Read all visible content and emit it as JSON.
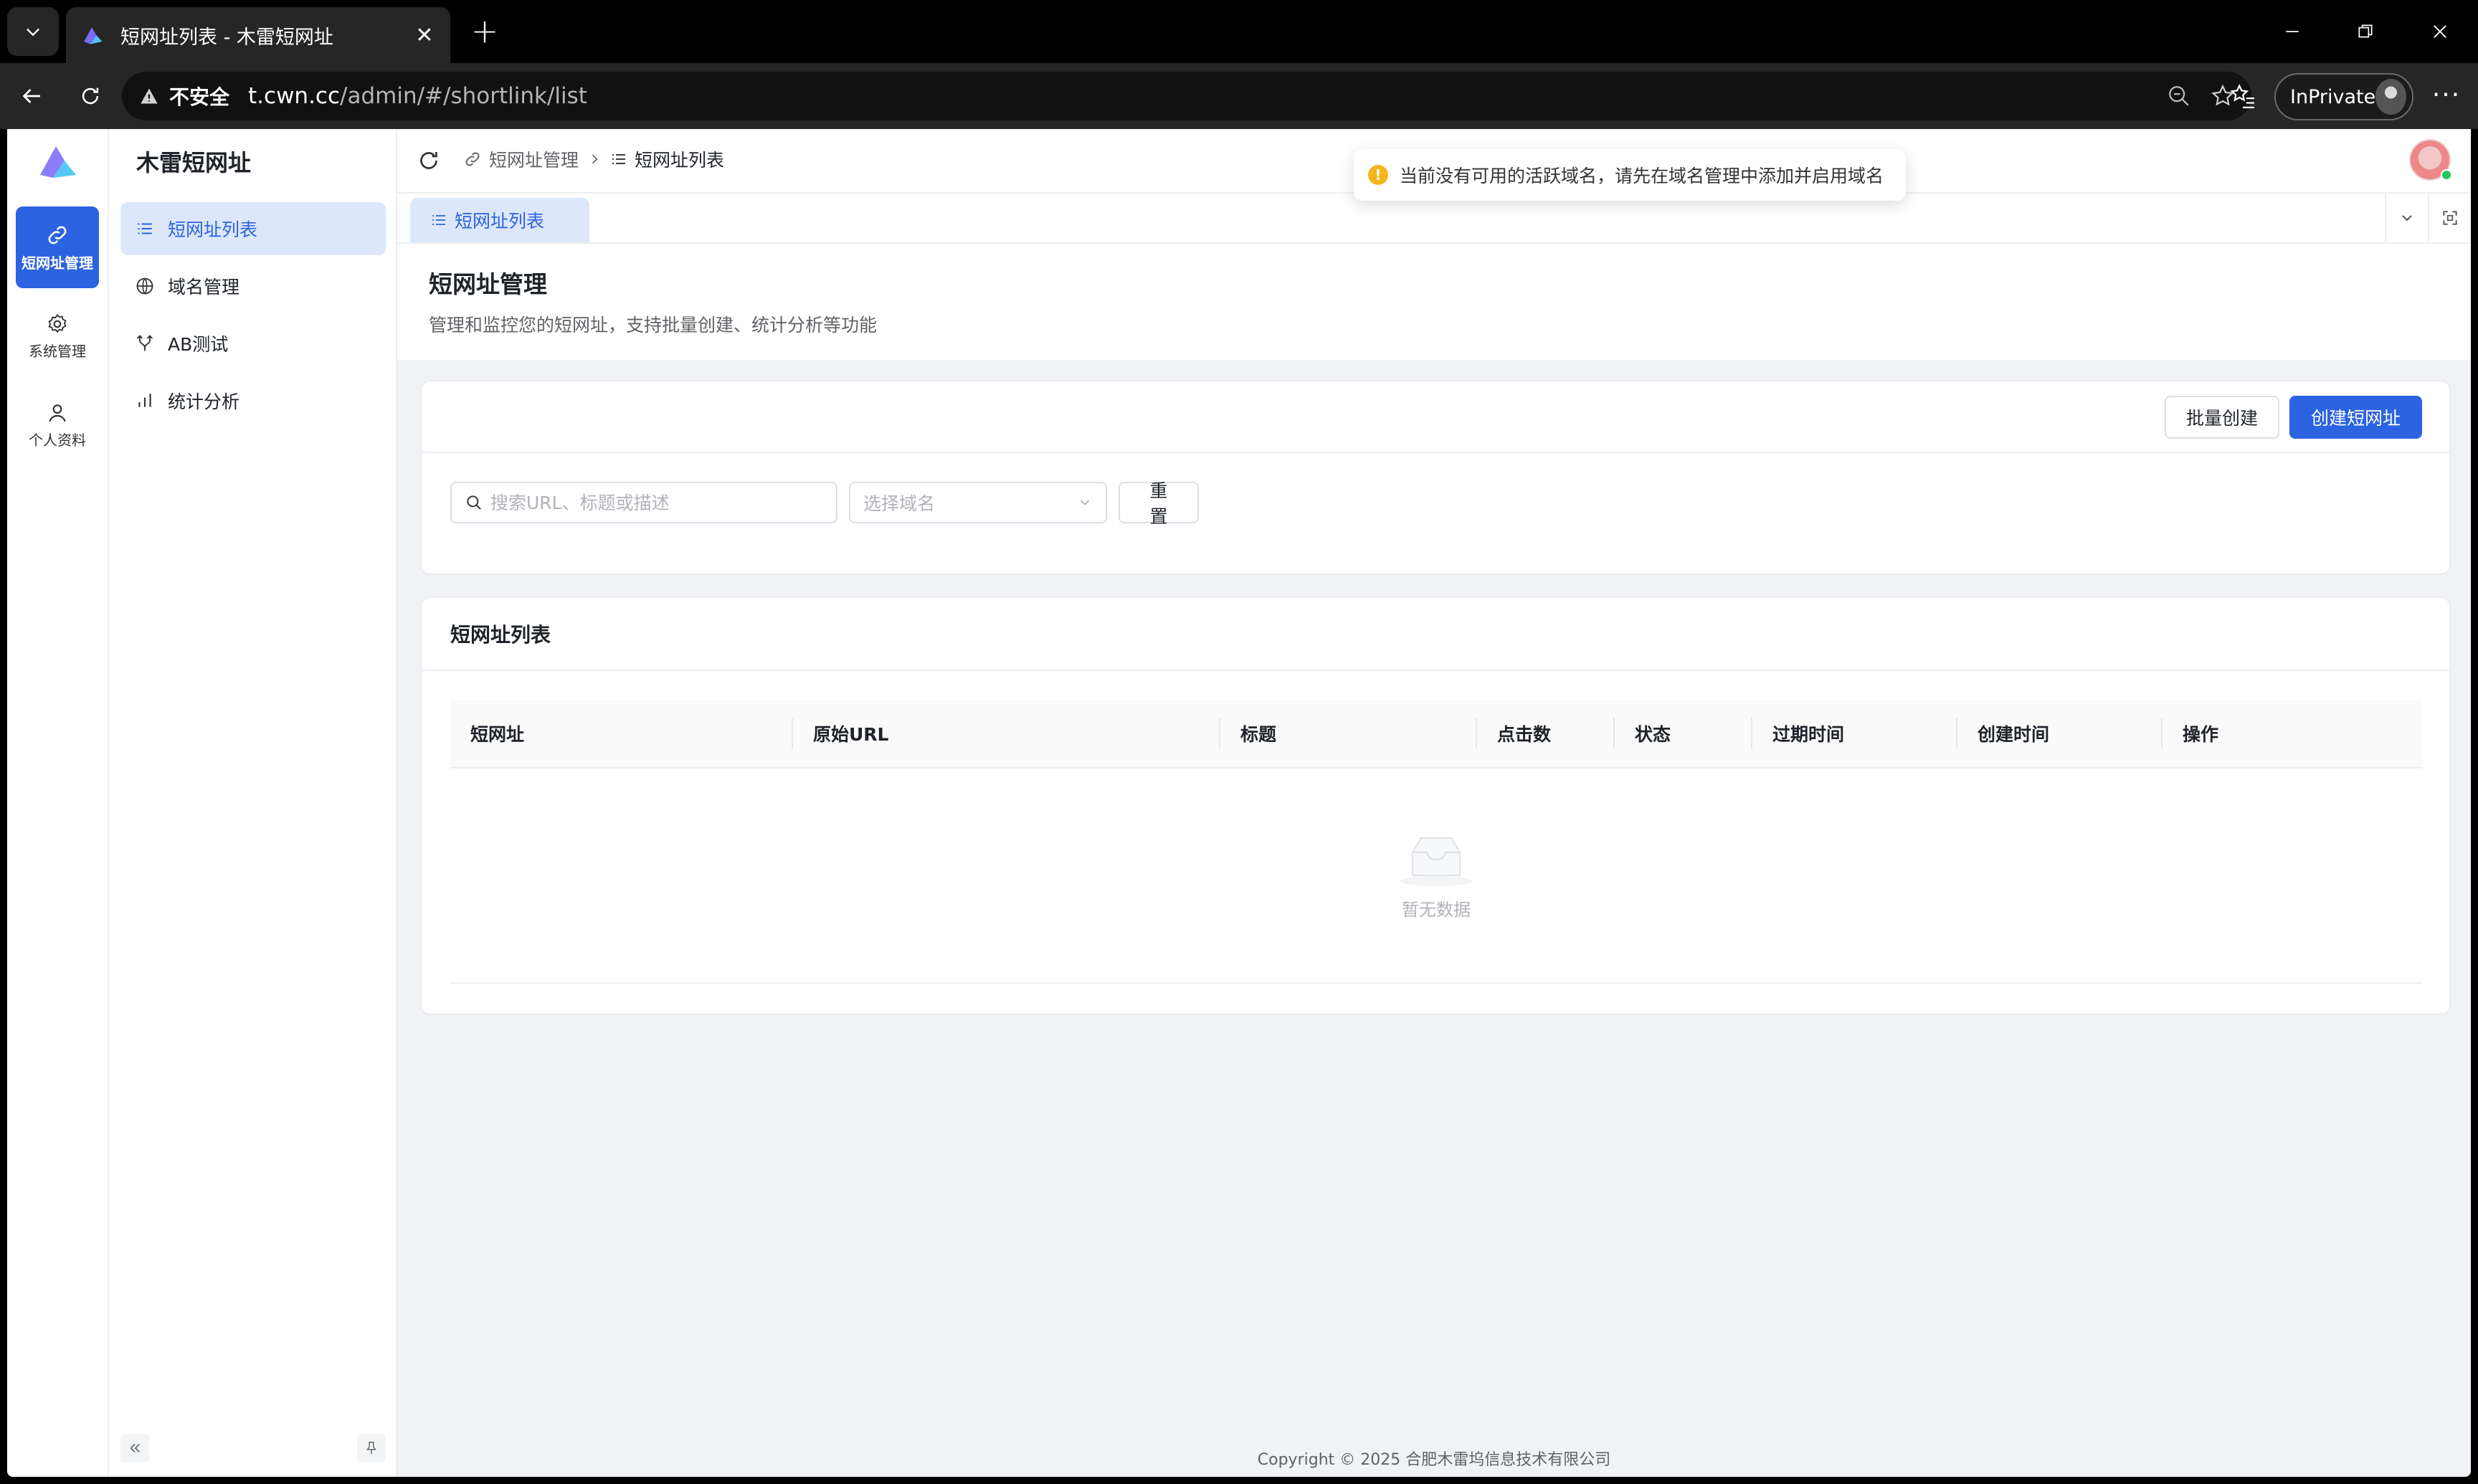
{
  "browser": {
    "tab_title": "短网址列表 - 木雷短网址",
    "security_label": "不安全",
    "url_host": "t.cwn.cc",
    "url_path": "/admin/#/shortlink/list",
    "inprivate_label": "InPrivate"
  },
  "rail": {
    "items": [
      {
        "label": "短网址管理",
        "icon": "link-icon",
        "active": true
      },
      {
        "label": "系统管理",
        "icon": "gear-icon",
        "active": false
      },
      {
        "label": "个人资料",
        "icon": "user-icon",
        "active": false
      }
    ]
  },
  "sidebar": {
    "brand": "木雷短网址",
    "items": [
      {
        "label": "短网址列表",
        "icon": "list-icon",
        "active": true
      },
      {
        "label": "域名管理",
        "icon": "globe-icon",
        "active": false
      },
      {
        "label": "AB测试",
        "icon": "ab-branch-icon",
        "active": false
      },
      {
        "label": "统计分析",
        "icon": "bar-chart-icon",
        "active": false
      }
    ]
  },
  "topbar": {
    "breadcrumb": [
      "短网址管理",
      "短网址列表"
    ]
  },
  "toast": {
    "message": "当前没有可用的活跃域名，请先在域名管理中添加并启用域名"
  },
  "tabs": [
    {
      "label": "短网址列表",
      "active": true
    }
  ],
  "page": {
    "title": "短网址管理",
    "description": "管理和监控您的短网址，支持批量创建、统计分析等功能"
  },
  "actions": {
    "batch_create": "批量创建",
    "create": "创建短网址"
  },
  "filters": {
    "search_placeholder": "搜索URL、标题或描述",
    "search_value": "",
    "domain_placeholder": "选择域名",
    "reset_label": "重 置"
  },
  "list": {
    "title": "短网址列表",
    "columns": [
      "短网址",
      "原始URL",
      "标题",
      "点击数",
      "状态",
      "过期时间",
      "创建时间",
      "操作"
    ],
    "rows": [],
    "empty_text": "暂无数据"
  },
  "footer": {
    "copyright": "Copyright © 2025 合肥木雷坞信息技术有限公司"
  },
  "colors": {
    "primary": "#2c63e0",
    "active_bg": "#dce7fb",
    "warning": "#f5b51c"
  }
}
